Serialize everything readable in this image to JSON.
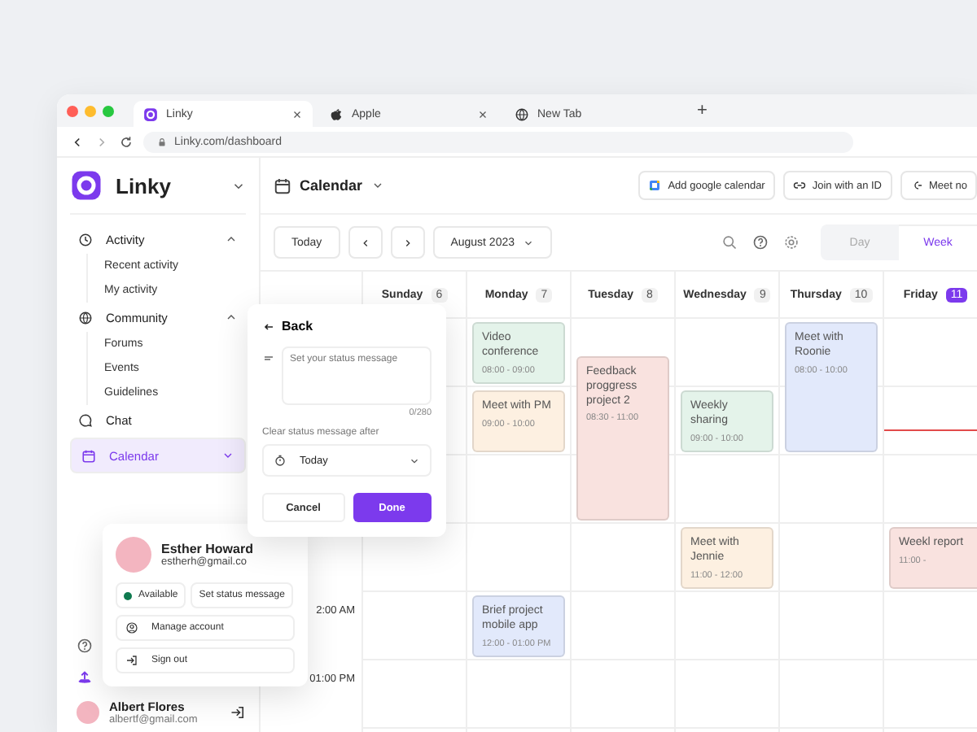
{
  "browser": {
    "tabs": [
      {
        "title": "Linky",
        "selected": true
      },
      {
        "title": "Apple",
        "selected": false
      },
      {
        "title": "New Tab",
        "selected": false
      }
    ],
    "new_tab": "+",
    "url": "Linky.com/dashboard"
  },
  "sidebar": {
    "brand": "Linky",
    "items": [
      {
        "label": "Activity",
        "expanded": true,
        "selected": false,
        "children": [
          {
            "label": "Recent activity"
          },
          {
            "label": "My activity"
          }
        ]
      },
      {
        "label": "Community",
        "expanded": true,
        "selected": false,
        "children": [
          {
            "label": "Forums"
          },
          {
            "label": "Events"
          },
          {
            "label": "Guidelines"
          }
        ]
      },
      {
        "label": "Chat",
        "selected": false
      },
      {
        "label": "Calendar",
        "expanded": false,
        "selected": true
      }
    ],
    "user": {
      "name": "Albert Flores",
      "email": "albertf@gmail.com"
    }
  },
  "header": {
    "title": "Calendar",
    "actions": [
      "Add google calendar",
      "Join with an ID",
      "Meet no"
    ]
  },
  "toolbar": {
    "today": "Today",
    "month": "August 2023",
    "views": [
      {
        "label": "Day",
        "selected": false
      },
      {
        "label": "Week",
        "selected": true
      }
    ]
  },
  "days": [
    {
      "name": "Sunday",
      "date": "6",
      "selected": false
    },
    {
      "name": "Monday",
      "date": "7",
      "selected": false,
      "events": [
        {
          "title": "Video conference",
          "time": "08:00 - 09:00",
          "color": "#e4f3ea"
        },
        {
          "title": "Meet with PM",
          "time": "09:00 - 10:00",
          "color": "#fdf0e1"
        },
        {
          "title": "Brief project mobile app",
          "time": "12:00 - 01:00 PM",
          "color": "#e2e9fb"
        }
      ]
    },
    {
      "name": "Tuesday",
      "date": "8",
      "selected": false,
      "events": [
        {
          "title": "Feedback proggress project 2",
          "time": "08:30 - 11:00",
          "color": "#f9e2df"
        }
      ]
    },
    {
      "name": "Wednesday",
      "date": "9",
      "selected": false,
      "events": [
        {
          "title": "Weekly sharing",
          "time": "09:00 - 10:00",
          "color": "#e4f3ea"
        },
        {
          "title": "Meet with Jennie",
          "time": "11:00 - 12:00",
          "color": "#fdf0e1"
        }
      ]
    },
    {
      "name": "Thursday",
      "date": "10",
      "selected": false,
      "events": [
        {
          "title": "Meet with Roonie",
          "time": "08:00 - 10:00",
          "color": "#e2e9fb"
        }
      ]
    },
    {
      "name": "Friday",
      "date": "11",
      "selected": true,
      "events": [
        {
          "title": "Weekl report",
          "time": "11:00 -",
          "color": "#f9e2df"
        }
      ]
    }
  ],
  "times": [
    "2:00 AM",
    "01:00 PM"
  ],
  "status_popup": {
    "back": "Back",
    "placeholder": "Set your status message",
    "counter": "0/280",
    "clear_label": "Clear status message after",
    "clear_after": "Today",
    "cancel": "Cancel",
    "done": "Done"
  },
  "profile_popup": {
    "name": "Esther Howard",
    "email": "estherh@gmail.co",
    "status": {
      "label": "Available",
      "color": "#0f7a4f"
    },
    "set_status": "Set status message",
    "actions": [
      "Manage account",
      "Sign out"
    ]
  }
}
